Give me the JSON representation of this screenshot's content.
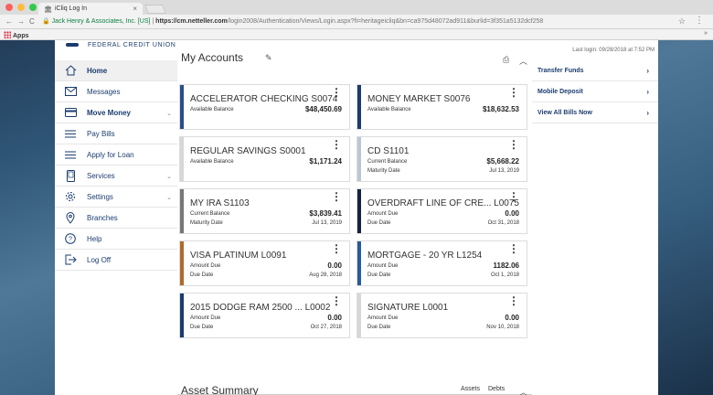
{
  "browser": {
    "tab_title": "iCliq Log In",
    "secure_label": "Jack Henry & Associates, Inc. [US]",
    "url_host": "https://cm.netteller.com",
    "url_path": "/login2008/Authentication/Views/Login.aspx?fi=heritageicliq&bn=ca975d48072ad911&burlid=3f351a5132dcf258",
    "bookmarks_label": "Apps"
  },
  "brand": {
    "name": "FEDERAL CREDIT UNION"
  },
  "header": {
    "last_login": "Last login: 09/28/2018 at 7:52 PM"
  },
  "sidebar": {
    "items": [
      {
        "label": "Home"
      },
      {
        "label": "Messages"
      },
      {
        "label": "Move Money"
      },
      {
        "label": "Pay Bills"
      },
      {
        "label": "Apply for Loan"
      },
      {
        "label": "Services"
      },
      {
        "label": "Settings"
      },
      {
        "label": "Branches"
      },
      {
        "label": "Help"
      },
      {
        "label": "Log Off"
      }
    ]
  },
  "main": {
    "title": "My Accounts",
    "asset_title": "Asset Summary",
    "asset_tabs": [
      "Assets",
      "Debts"
    ]
  },
  "accounts": [
    {
      "name": "ACCELERATOR CHECKING S0074",
      "row1_label": "Available Balance",
      "row1_value": "$48,450.69",
      "row2_label": "",
      "row2_value": "",
      "color": "#2a4d8f"
    },
    {
      "name": "MONEY MARKET S0076",
      "row1_label": "Available Balance",
      "row1_value": "$18,632.53",
      "row2_label": "",
      "row2_value": "",
      "color": "#1a3c6e"
    },
    {
      "name": "REGULAR SAVINGS S0001",
      "row1_label": "Available Balance",
      "row1_value": "$1,171.24",
      "row2_label": "",
      "row2_value": "",
      "color": "#d7d7d7"
    },
    {
      "name": "CD S1101",
      "row1_label": "Current Balance",
      "row1_value": "$5,668.22",
      "row2_label": "Maturity Date",
      "row2_value": "Jul 13, 2019",
      "color": "#b9c6d6"
    },
    {
      "name": "MY IRA S1103",
      "row1_label": "Current Balance",
      "row1_value": "$3,839.41",
      "row2_label": "Maturity Date",
      "row2_value": "Jul 13, 2019",
      "color": "#777777"
    },
    {
      "name": "OVERDRAFT LINE OF CRE... L0075",
      "row1_label": "Amount Due",
      "row1_value": "0.00",
      "row2_label": "Due Date",
      "row2_value": "Oct 31, 2018",
      "color": "#16233f"
    },
    {
      "name": "VISA PLATINUM L0091",
      "row1_label": "Amount Due",
      "row1_value": "0.00",
      "row2_label": "Due Date",
      "row2_value": "Aug 28, 2018",
      "color": "#b06a2a"
    },
    {
      "name": "MORTGAGE - 20 YR L1254",
      "row1_label": "Amount Due",
      "row1_value": "1182.06",
      "row2_label": "Due Date",
      "row2_value": "Oct 1, 2018",
      "color": "#2a5a9a"
    },
    {
      "name": "2015 DODGE RAM 2500 ... L0002",
      "row1_label": "Amount Due",
      "row1_value": "0.00",
      "row2_label": "Due Date",
      "row2_value": "Oct 27, 2018",
      "color": "#1a3c6e"
    },
    {
      "name": "SIGNATURE L0001",
      "row1_label": "Amount Due",
      "row1_value": "0.00",
      "row2_label": "Due Date",
      "row2_value": "Nov 10, 2018",
      "color": "#d7d7d7"
    }
  ],
  "quick_links": [
    {
      "label": "Transfer Funds"
    },
    {
      "label": "Mobile Deposit"
    },
    {
      "label": "View All Bills Now"
    }
  ]
}
